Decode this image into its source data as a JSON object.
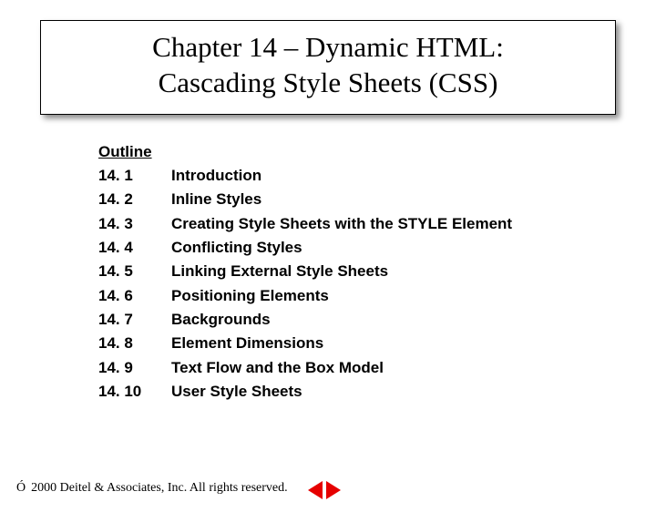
{
  "title": {
    "line1": "Chapter 14 – Dynamic HTML:",
    "line2": "Cascading Style Sheets (CSS)"
  },
  "outline": {
    "heading": "Outline",
    "items": [
      {
        "num": "14. 1",
        "label": "Introduction"
      },
      {
        "num": "14. 2",
        "label": "Inline Styles"
      },
      {
        "num": "14. 3",
        "label": "Creating Style Sheets with the STYLE Element"
      },
      {
        "num": "14. 4",
        "label": "Conflicting Styles"
      },
      {
        "num": "14. 5",
        "label": "Linking External Style Sheets"
      },
      {
        "num": "14. 6",
        "label": "Positioning Elements"
      },
      {
        "num": "14. 7",
        "label": "Backgrounds"
      },
      {
        "num": "14. 8",
        "label": "Element Dimensions"
      },
      {
        "num": "14. 9",
        "label": "Text Flow and the Box Model"
      },
      {
        "num": "14. 10",
        "label": "User Style Sheets"
      }
    ]
  },
  "footer": {
    "symbol": "Ó",
    "text": "2000 Deitel & Associates, Inc.  All rights reserved."
  }
}
